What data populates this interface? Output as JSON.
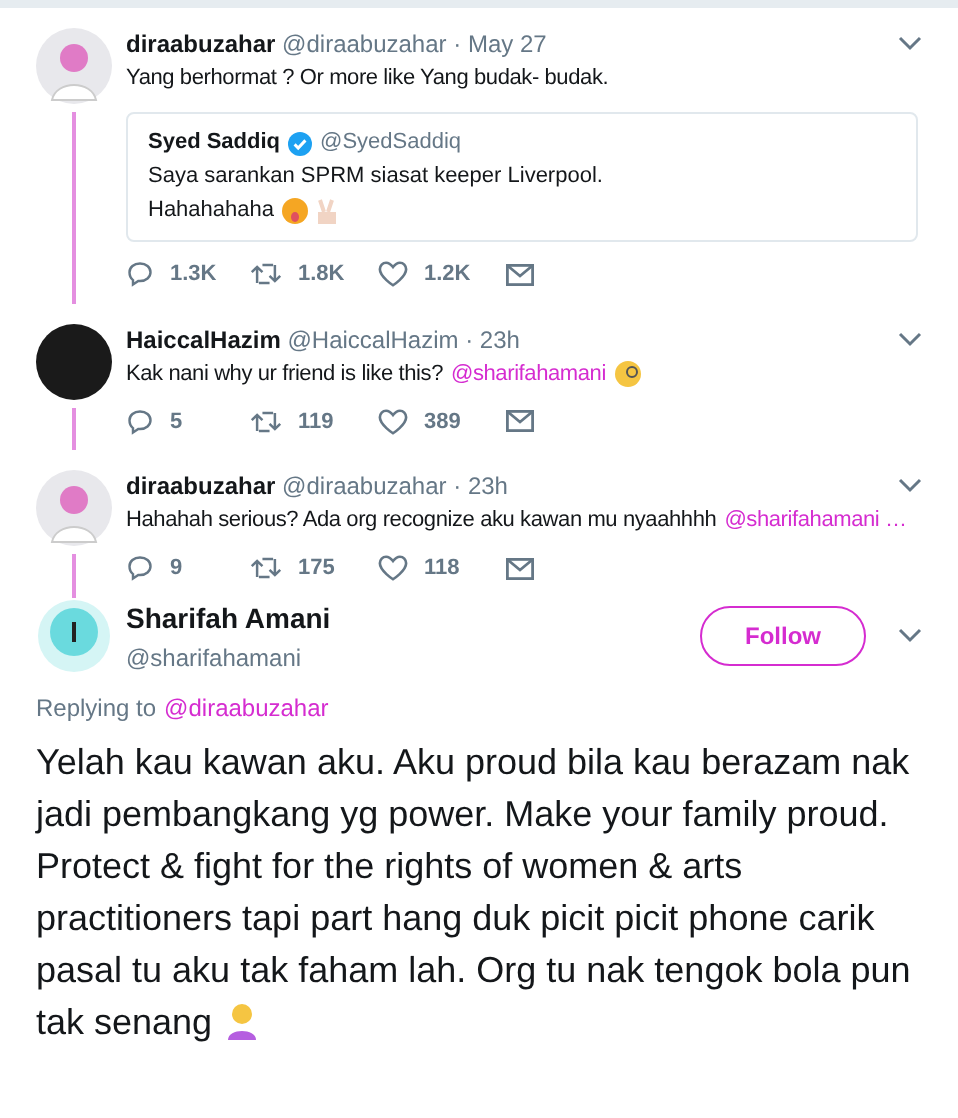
{
  "thread": [
    {
      "name": "diraabuzahar",
      "handle": "@diraabuzahar",
      "time": "· May 27",
      "text": "Yang berhormat ? Or more like Yang budak- budak.",
      "kind": "person",
      "quote": {
        "name": "Syed Saddiq",
        "handle": "@SyedSaddiq",
        "lines": [
          "Saya sarankan SPRM siasat keeper Liverpool.",
          "Hahahahaha"
        ]
      },
      "stats": {
        "replies": "1.3K",
        "retweets": "1.8K",
        "likes": "1.2K"
      }
    },
    {
      "name": "HaiccalHazim",
      "handle": "@HaiccalHazim",
      "time": "· 23h",
      "text": "Kak nani why ur friend is like this?",
      "mention": "@sharifahamani",
      "kind": "dark",
      "stats": {
        "replies": "5",
        "retweets": "119",
        "likes": "389"
      }
    },
    {
      "name": "diraabuzahar",
      "handle": "@diraabuzahar",
      "time": "· 23h",
      "text": "Hahahah serious? Ada org recognize aku kawan mu nyaahhhh",
      "mention": "@sharifahamani …",
      "kind": "person",
      "stats": {
        "replies": "9",
        "retweets": "175",
        "likes": "118"
      }
    }
  ],
  "main": {
    "name": "Sharifah Amani",
    "handle": "@sharifahamani",
    "follow": "Follow",
    "replying_label": "Replying to",
    "replying_to": "@diraabuzahar",
    "text": "Yelah kau kawan aku. Aku proud bila kau berazam nak jadi pembangkang yg power. Make your family proud. Protect & fight for the rights of women & arts practitioners tapi part hang duk picit picit phone carik pasal tu aku tak faham lah. Org tu nak tengok bola pun tak senang"
  }
}
